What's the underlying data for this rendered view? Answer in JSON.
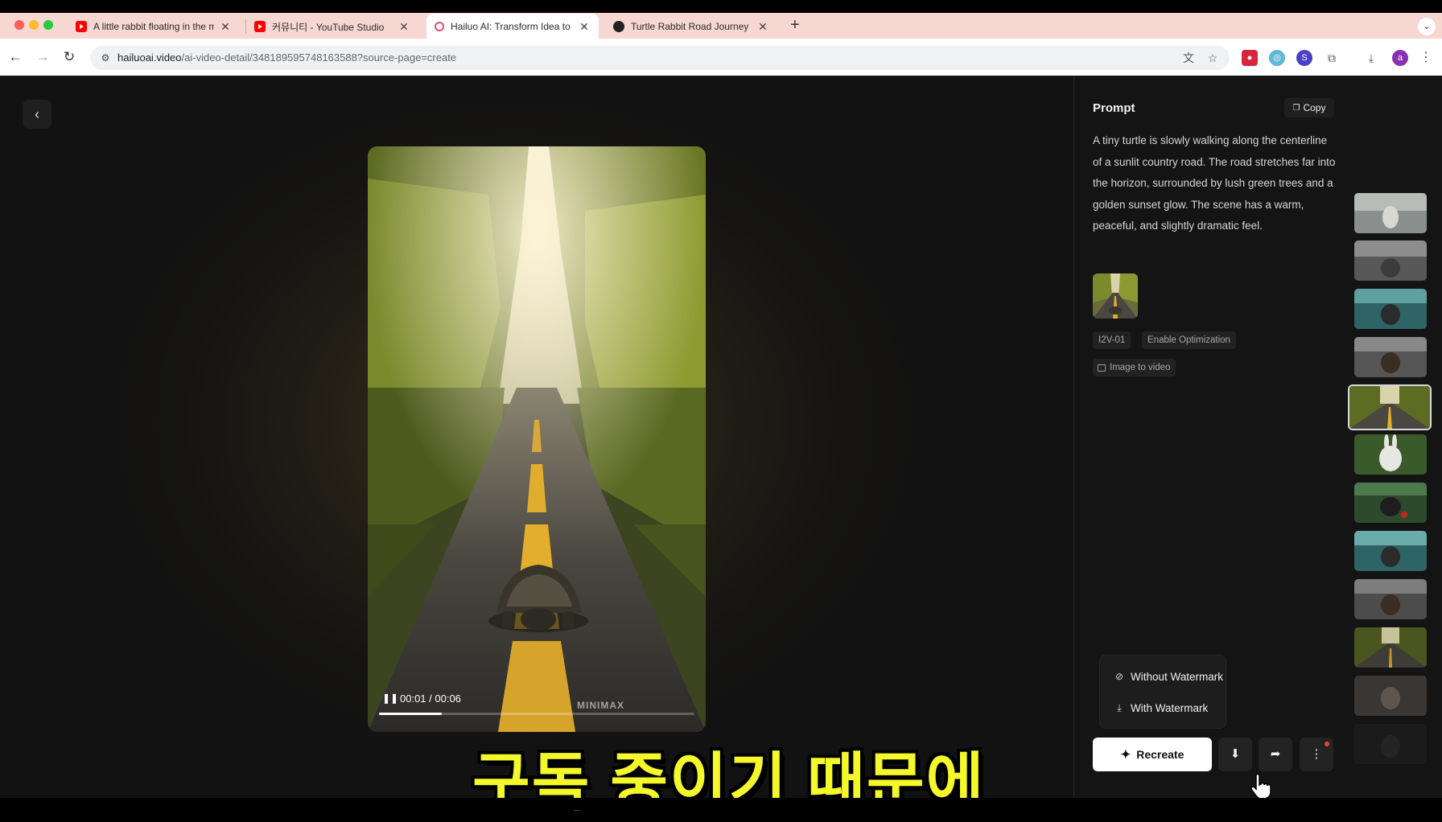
{
  "browser": {
    "tabs": [
      {
        "title": "A little rabbit floating in the m",
        "icon": "youtube-icon",
        "active": false
      },
      {
        "title": "커뮤니티 - YouTube Studio",
        "icon": "youtube-icon",
        "active": false
      },
      {
        "title": "Hailuo AI: Transform Idea to V",
        "icon": "hailuo-icon",
        "active": true
      },
      {
        "title": "Turtle Rabbit Road Journey",
        "icon": "chatgpt-icon",
        "active": false
      }
    ],
    "new_tab": "+",
    "url_host": "hailuoai.video",
    "url_path": "/ai-video-detail/348189595748163588?source-page=create",
    "profile_initial": "a"
  },
  "player": {
    "time": "00:01 / 00:06",
    "progress": 0.2,
    "watermark": "MINIMAX"
  },
  "subtitle": "구독 중이기 때문에",
  "panel": {
    "prompt_title": "Prompt",
    "copy_label": "Copy",
    "prompt_text": "A tiny turtle is slowly walking along the centerline of a sunlit country road. The road stretches far into the horizon, surrounded by lush green trees and a golden sunset glow. The scene has a warm, peaceful, and slightly dramatic feel.",
    "tags": [
      "I2V-01",
      "Enable Optimization"
    ],
    "mode_tag": "Image to video",
    "download_menu": [
      "Without Watermark",
      "With Watermark"
    ],
    "recreate_label": "Recreate"
  },
  "colors": {
    "subtitle": "#f4f72a",
    "accent_red": "#ff3b3b",
    "panel_bg": "#141414"
  }
}
